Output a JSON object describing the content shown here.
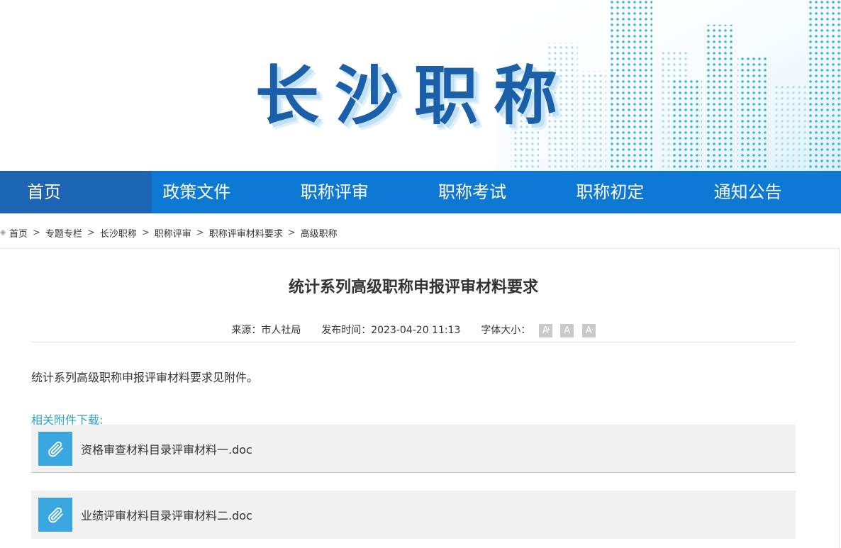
{
  "header": {
    "site_title": "长沙职称",
    "accent_color": "#1a5fa8"
  },
  "nav": {
    "items": [
      {
        "label": "首页",
        "active": true
      },
      {
        "label": "政策文件"
      },
      {
        "label": "职称评审"
      },
      {
        "label": "职称考试"
      },
      {
        "label": "职称初定"
      },
      {
        "label": "通知公告"
      }
    ],
    "bg_color": "#0e79d4",
    "active_color": "#1d64b4"
  },
  "breadcrumb": {
    "icon": "location-icon",
    "items": [
      "首页",
      "专题专栏",
      "长沙职称",
      "职称评审",
      "职称评审材料要求",
      "高级职称"
    ],
    "separator": ">"
  },
  "article": {
    "title": "统计系列高级职称申报评审材料要求",
    "source_label": "来源：市人社局",
    "publish_label": "发布时间：2023-04-20 11:13",
    "font_size_label": "字体大小：",
    "font_buttons": [
      "A",
      "A",
      "A"
    ],
    "body": "统计系列高级职称申报评审材料要求见附件。",
    "attachments_heading": "相关附件下载:",
    "attachments": [
      {
        "name": "资格审查材料目录评审材料一.doc",
        "icon": "paperclip-icon"
      },
      {
        "name": "业绩评审材料目录评审材料二.doc",
        "icon": "paperclip-icon"
      }
    ],
    "link_color": "#2aa0c8",
    "clip_bg": "#3aa7e0"
  }
}
